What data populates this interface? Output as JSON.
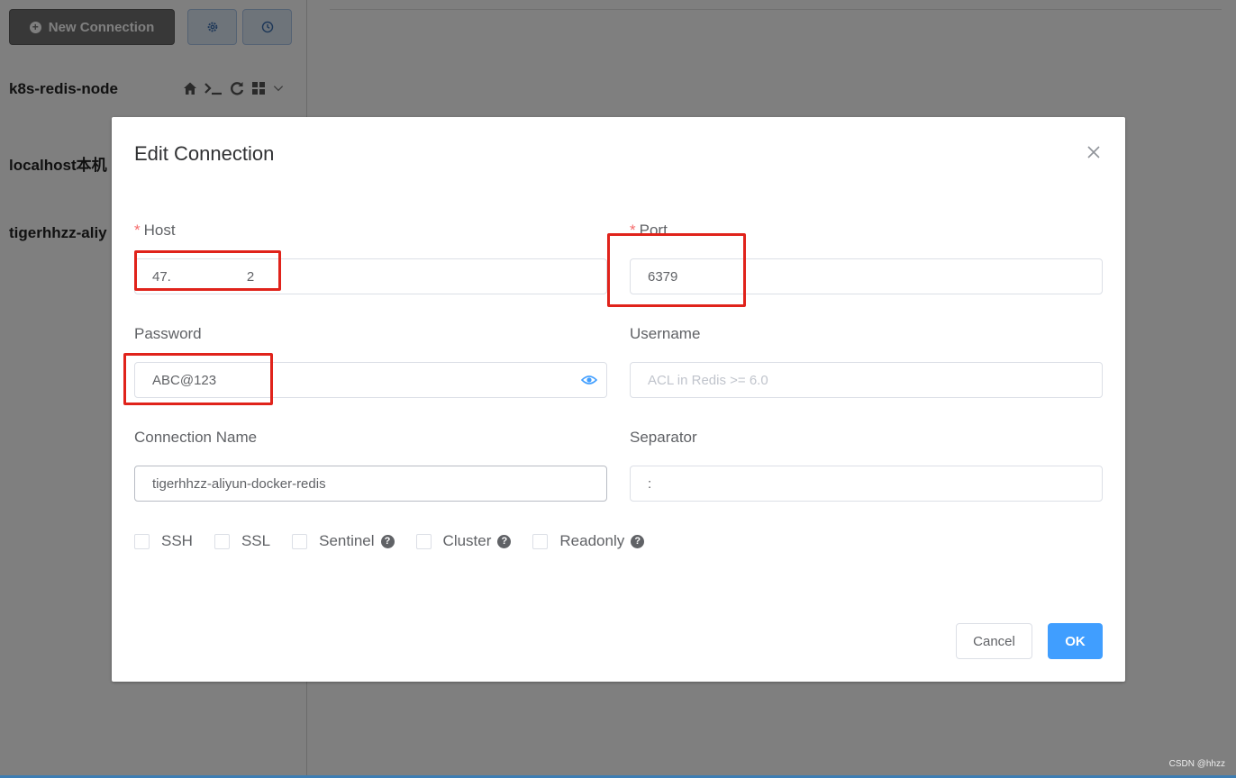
{
  "sidebar": {
    "new_connection_label": "New Connection",
    "connections": [
      {
        "name": "k8s-redis-node"
      },
      {
        "name": "localhost本机"
      },
      {
        "name": "tigerhhzz-aliy"
      }
    ],
    "tool_icons": [
      "home-icon",
      "terminal-icon",
      "refresh-icon",
      "grid-icon",
      "chevron-down-icon"
    ]
  },
  "dialog": {
    "title": "Edit Connection",
    "host": {
      "label": "Host",
      "required": true,
      "value": "47.",
      "value_tail": "2"
    },
    "port": {
      "label": "Port",
      "required": true,
      "value": "6379"
    },
    "password": {
      "label": "Password",
      "value": "ABC@123"
    },
    "username": {
      "label": "Username",
      "placeholder": "ACL in Redis >= 6.0"
    },
    "connection_name": {
      "label": "Connection Name",
      "value": "tigerhhzz-aliyun-docker-redis"
    },
    "separator": {
      "label": "Separator",
      "value": ":"
    },
    "options": [
      {
        "label": "SSH",
        "checked": false,
        "help": false
      },
      {
        "label": "SSL",
        "checked": false,
        "help": false
      },
      {
        "label": "Sentinel",
        "checked": false,
        "help": true
      },
      {
        "label": "Cluster",
        "checked": false,
        "help": true
      },
      {
        "label": "Readonly",
        "checked": false,
        "help": true
      }
    ],
    "help_glyph": "?",
    "cancel_label": "Cancel",
    "ok_label": "OK",
    "required_mark": "*"
  },
  "watermark": "CSDN @hhzz",
  "colors": {
    "primary": "#409eff",
    "annotation": "#e0231b",
    "required": "#f56c6c"
  }
}
